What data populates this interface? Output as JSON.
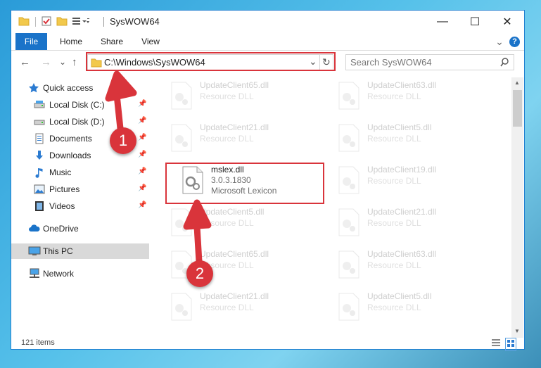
{
  "window": {
    "title": "SysWOW64",
    "minimize_symbol": "—",
    "maximize_symbol": "☐",
    "close_symbol": "✕"
  },
  "ribbon": {
    "tabs": [
      "File",
      "Home",
      "Share",
      "View"
    ],
    "expand_symbol": "⌄",
    "help_symbol": "?"
  },
  "address": {
    "path": "C:\\Windows\\SysWOW64",
    "dropdown_symbol": "⌄",
    "refresh_symbol": "↻"
  },
  "search": {
    "placeholder": "Search SysWOW64",
    "icon": "search-icon"
  },
  "nav_buttons": {
    "back": "←",
    "forward": "→",
    "recent": "⌄",
    "up": "↑"
  },
  "sidebar": {
    "items": [
      {
        "label": "Quick access",
        "icon": "star-icon",
        "pinned": false
      },
      {
        "label": "Local Disk (C:)",
        "icon": "drive-icon",
        "pinned": true
      },
      {
        "label": "Local Disk (D:)",
        "icon": "drive-icon",
        "pinned": true
      },
      {
        "label": "Documents",
        "icon": "documents-icon",
        "pinned": true
      },
      {
        "label": "Downloads",
        "icon": "download-icon",
        "pinned": true
      },
      {
        "label": "Music",
        "icon": "music-icon",
        "pinned": true
      },
      {
        "label": "Pictures",
        "icon": "pictures-icon",
        "pinned": true
      },
      {
        "label": "Videos",
        "icon": "videos-icon",
        "pinned": true
      },
      {
        "label": "OneDrive",
        "icon": "cloud-icon",
        "pinned": false
      },
      {
        "label": "This PC",
        "icon": "computer-icon",
        "pinned": false,
        "selected": true
      },
      {
        "label": "Network",
        "icon": "network-icon",
        "pinned": false
      }
    ],
    "pin_symbol": "📌"
  },
  "files": [
    {
      "name": "UpdateClient65.dll",
      "line1": "Resource DLL",
      "line2": "",
      "highlighted": false
    },
    {
      "name": "UpdateClient63.dll",
      "line1": "Resource DLL",
      "line2": "",
      "highlighted": false
    },
    {
      "name": "UpdateClient21.dll",
      "line1": "Resource DLL",
      "line2": "",
      "highlighted": false
    },
    {
      "name": "UpdateClient5.dll",
      "line1": "Resource DLL",
      "line2": "",
      "highlighted": false
    },
    {
      "name": "mslex.dll",
      "line1": "3.0.3.1830",
      "line2": "Microsoft Lexicon",
      "highlighted": true
    },
    {
      "name": "UpdateClient19.dll",
      "line1": "Resource DLL",
      "line2": "",
      "highlighted": false
    },
    {
      "name": "UpdateClient5.dll",
      "line1": "Resource DLL",
      "line2": "",
      "highlighted": false
    },
    {
      "name": "UpdateClient21.dll",
      "line1": "Resource DLL",
      "line2": "",
      "highlighted": false
    },
    {
      "name": "UpdateClient65.dll",
      "line1": "Resource DLL",
      "line2": "",
      "highlighted": false
    },
    {
      "name": "UpdateClient63.dll",
      "line1": "Resource DLL",
      "line2": "",
      "highlighted": false
    },
    {
      "name": "UpdateClient21.dll",
      "line1": "Resource DLL",
      "line2": "",
      "highlighted": false
    },
    {
      "name": "UpdateClient5.dll",
      "line1": "Resource DLL",
      "line2": "",
      "highlighted": false
    }
  ],
  "status": {
    "item_count": "121 items"
  },
  "annotations": {
    "step1": "1",
    "step2": "2",
    "color": "#d9343b"
  }
}
